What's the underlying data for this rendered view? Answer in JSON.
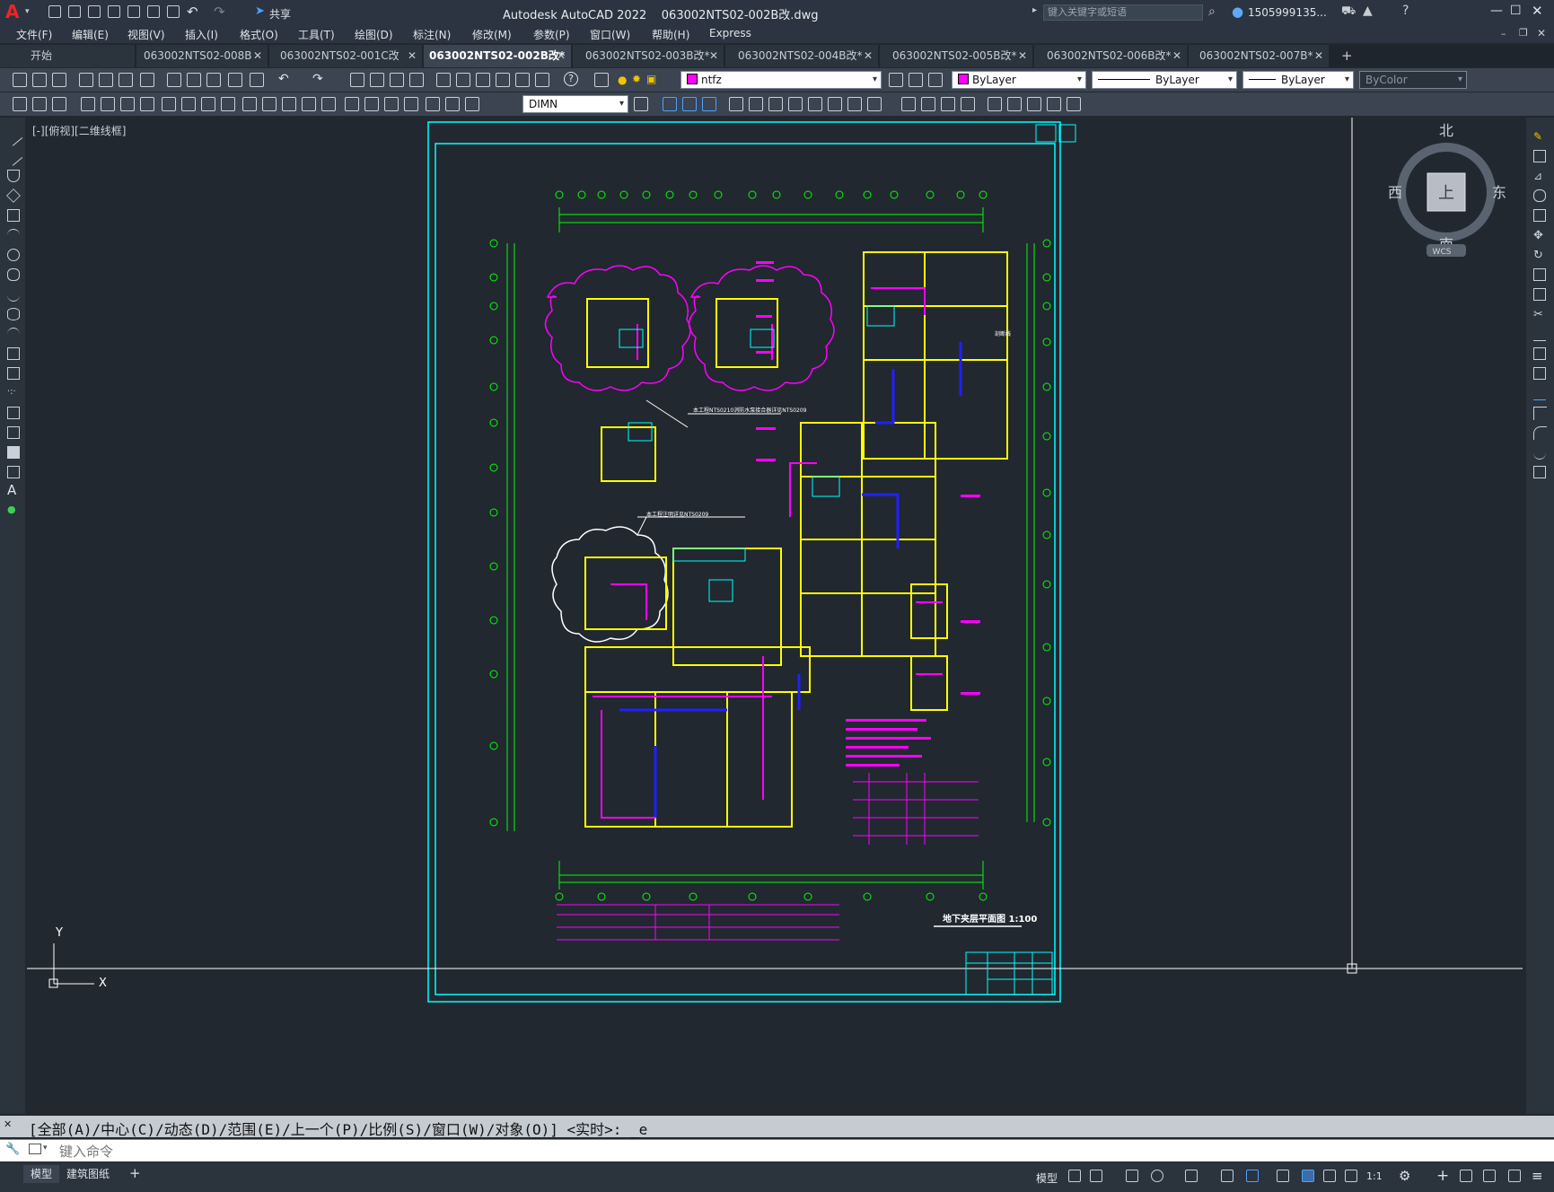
{
  "app": {
    "title": "Autodesk AutoCAD 2022",
    "file": "063002NTS02-002B改.dwg",
    "search_placeholder": "键入关键字或短语",
    "user": "1505999135...",
    "share_label": "共享"
  },
  "menu": [
    "文件(F)",
    "编辑(E)",
    "视图(V)",
    "插入(I)",
    "格式(O)",
    "工具(T)",
    "绘图(D)",
    "标注(N)",
    "修改(M)",
    "参数(P)",
    "窗口(W)",
    "帮助(H)",
    "Express"
  ],
  "tabs": [
    {
      "label": "开始",
      "active": false,
      "close": false
    },
    {
      "label": "063002NTS02-008B",
      "active": false,
      "close": true
    },
    {
      "label": "063002NTS02-001C改",
      "active": false,
      "close": true
    },
    {
      "label": "063002NTS02-002B改*",
      "active": true,
      "close": true
    },
    {
      "label": "063002NTS02-003B改*",
      "active": false,
      "close": true
    },
    {
      "label": "063002NTS02-004B改*",
      "active": false,
      "close": true
    },
    {
      "label": "063002NTS02-005B改*",
      "active": false,
      "close": true
    },
    {
      "label": "063002NTS02-006B改*",
      "active": false,
      "close": true
    },
    {
      "label": "063002NTS02-007B*",
      "active": false,
      "close": true
    }
  ],
  "properties": {
    "layer": "ntfz",
    "color": "ByLayer",
    "linetype": "ByLayer",
    "lineweight": "ByLayer",
    "plotstyle": "ByColor",
    "dimstyle": "DIMN",
    "layer_color": "#ff00ff"
  },
  "viewport_label": "[-][俯视][二维线框]",
  "viewcube": {
    "north": "北",
    "south": "南",
    "east": "东",
    "west": "西",
    "top": "上",
    "wcs": "WCS"
  },
  "ucs": {
    "x": "X",
    "y": "Y"
  },
  "drawing_texts": {
    "plan_title": "地下夹层平面图   1:100",
    "note1": "本工程NTS0210消防水泵接合器详见NTS0209",
    "note2": "本工程注明详见NTS0209",
    "cut_line": "剖断线"
  },
  "command": {
    "history": "[全部(A)/中心(C)/动态(D)/范围(E)/上一个(P)/比例(S)/窗口(W)/对象(O)] <实时>: _e",
    "placeholder": "键入命令"
  },
  "status": {
    "tabs": [
      {
        "label": "模型",
        "active": true
      },
      {
        "label": "建筑图纸",
        "active": false
      }
    ],
    "model_label": "模型",
    "scale": "1:1"
  },
  "colors": {
    "cyan": "#00ffff",
    "magenta": "#ff00ff",
    "yellow": "#ffff00",
    "green": "#00ff00",
    "blue": "#0000ff",
    "white": "#ffffff",
    "background": "#212830"
  }
}
